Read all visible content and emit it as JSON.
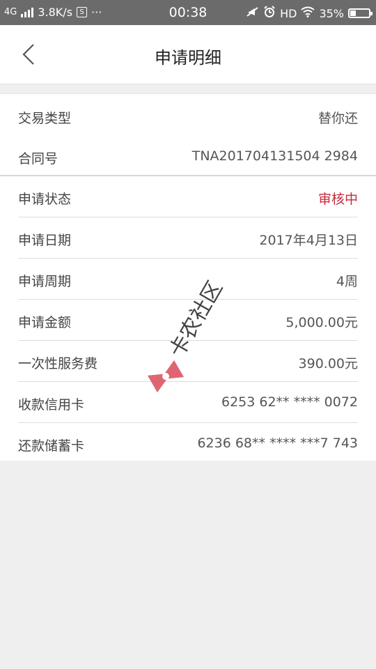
{
  "status_bar": {
    "network": "4G",
    "speed": "3.8K/s",
    "time": "00:38",
    "hd": "HD",
    "battery": "35%"
  },
  "header": {
    "title": "申请明细",
    "back_icon": "chevron-left-icon"
  },
  "details": [
    {
      "label": "交易类型",
      "value": "替你还"
    },
    {
      "label": "合同号",
      "value": "TNA201704131504 2984"
    },
    {
      "label": "申请状态",
      "value": "审核中"
    },
    {
      "label": "申请日期",
      "value": "2017年4月13日"
    },
    {
      "label": "申请周期",
      "value": "4周"
    },
    {
      "label": "申请金额",
      "value": "5,000.00元"
    },
    {
      "label": "一次性服务费",
      "value": "390.00元"
    },
    {
      "label": "收款信用卡",
      "value": "6253 62** **** 0072"
    },
    {
      "label": "还款储蓄卡",
      "value": "6236 68** **** ***7 743"
    }
  ],
  "watermark": {
    "text": "卡农社区"
  },
  "colors": {
    "status_red": "#c9283a",
    "status_bar": "#6b6b6b"
  }
}
